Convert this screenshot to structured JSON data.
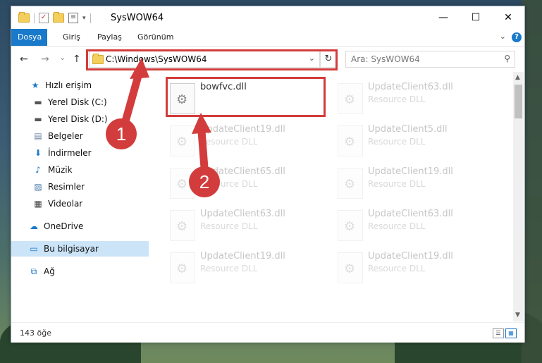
{
  "window": {
    "title": "SysWOW64",
    "minimize": "—",
    "maximize": "☐",
    "close": "✕"
  },
  "ribbon": {
    "tabs": [
      "Dosya",
      "Giriş",
      "Paylaş",
      "Görünüm"
    ],
    "help": "?"
  },
  "address": {
    "back": "←",
    "forward": "→",
    "recent": "⌄",
    "up": "↑",
    "path": "C:\\Windows\\SysWOW64",
    "refresh": "↻",
    "search_placeholder": "Ara: SysWOW64"
  },
  "sidebar": {
    "items": [
      {
        "label": "Hızlı erişim",
        "icon": "star-icon"
      },
      {
        "label": "Yerel Disk (C:)",
        "icon": "drive-icon",
        "pinned": true
      },
      {
        "label": "Yerel Disk (D:)",
        "icon": "drive-icon",
        "pinned": true
      },
      {
        "label": "Belgeler",
        "icon": "documents-icon",
        "pinned": true
      },
      {
        "label": "İndirmeler",
        "icon": "downloads-icon",
        "pinned": true
      },
      {
        "label": "Müzik",
        "icon": "music-icon",
        "pinned": true
      },
      {
        "label": "Resimler",
        "icon": "pictures-icon",
        "pinned": true
      },
      {
        "label": "Videolar",
        "icon": "videos-icon",
        "pinned": true
      },
      {
        "label": "OneDrive",
        "icon": "cloud-icon"
      },
      {
        "label": "Bu bilgisayar",
        "icon": "computer-icon",
        "selected": true
      },
      {
        "label": "Ağ",
        "icon": "network-icon"
      }
    ]
  },
  "files": [
    {
      "name": "bowfvc.dll",
      "type": ""
    },
    {
      "name": "UpdateClient63.dll",
      "type": "Resource DLL"
    },
    {
      "name": "UpdateClient19.dll",
      "type": "Resource DLL"
    },
    {
      "name": "UpdateClient5.dll",
      "type": "Resource DLL"
    },
    {
      "name": "UpdateClient65.dll",
      "type": "Resource DLL"
    },
    {
      "name": "UpdateClient19.dll",
      "type": "Resource DLL"
    },
    {
      "name": "UpdateClient63.dll",
      "type": "Resource DLL"
    },
    {
      "name": "UpdateClient63.dll",
      "type": "Resource DLL"
    },
    {
      "name": "UpdateClient19.dll",
      "type": "Resource DLL"
    },
    {
      "name": "UpdateClient19.dll",
      "type": "Resource DLL"
    }
  ],
  "status": {
    "count": "143 öğe"
  },
  "callouts": [
    "1",
    "2"
  ],
  "colors": {
    "accent": "#1979ca",
    "highlight": "#d33c3c",
    "selected": "#cce4f7"
  }
}
